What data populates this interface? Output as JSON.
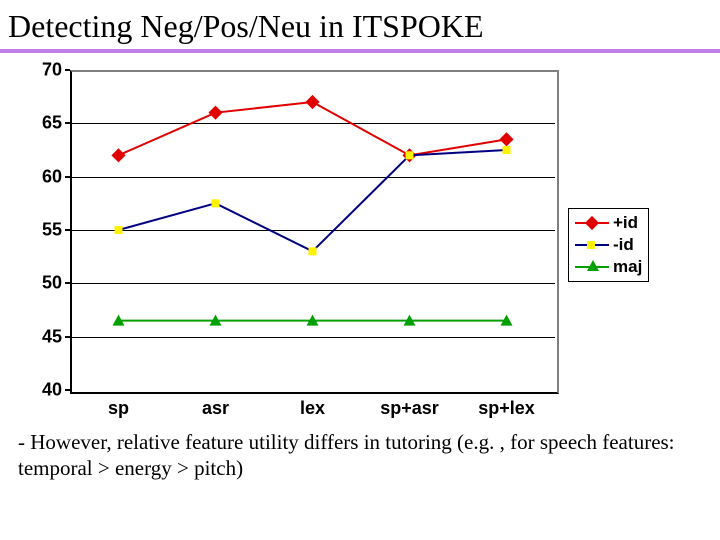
{
  "title": "Detecting Neg/Pos/Neu in ITSPOKE",
  "caption": "- However, relative feature utility differs in tutoring (e.g. , for speech features: temporal > energy > pitch)",
  "legend": [
    {
      "label": "+id",
      "color": "#e00000",
      "marker": "diamond"
    },
    {
      "label": "-id",
      "color": "#fff200",
      "marker": "square",
      "line": "#000080"
    },
    {
      "label": "maj",
      "color": "#00a000",
      "marker": "triangle"
    }
  ],
  "chart_data": {
    "type": "line",
    "categories": [
      "sp",
      "asr",
      "lex",
      "sp+asr",
      "sp+lex"
    ],
    "ylim": [
      40,
      70
    ],
    "yticks": [
      40,
      45,
      50,
      55,
      60,
      65,
      70
    ],
    "series": [
      {
        "name": "+id",
        "values": [
          62,
          66,
          67,
          62,
          63.5
        ]
      },
      {
        "name": "-id",
        "values": [
          55,
          57.5,
          53,
          62,
          62.5
        ]
      },
      {
        "name": "maj",
        "values": [
          46.5,
          46.5,
          46.5,
          46.5,
          46.5
        ]
      }
    ]
  }
}
